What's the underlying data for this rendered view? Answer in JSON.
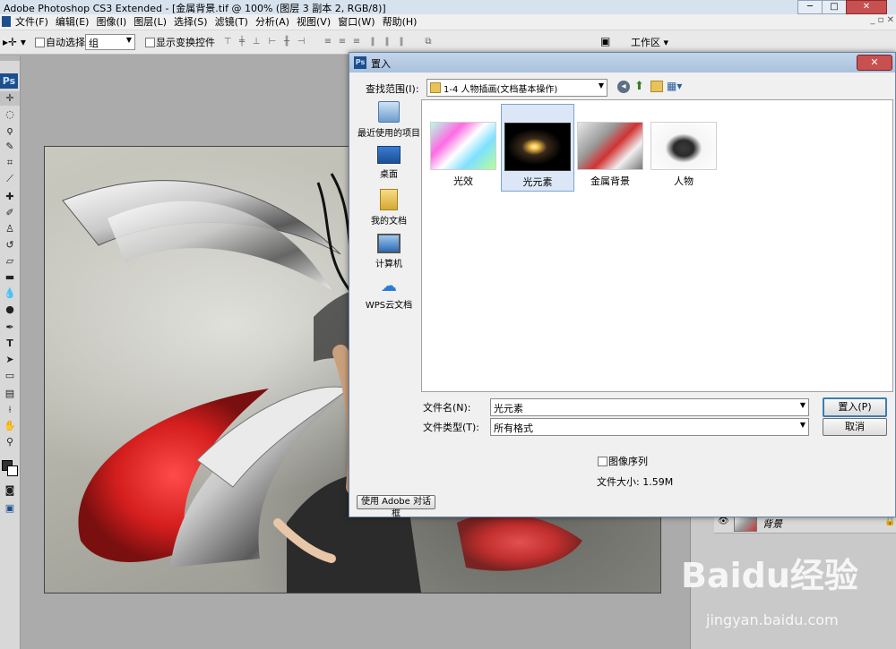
{
  "window": {
    "title": "Adobe Photoshop CS3 Extended - [金属背景.tif @ 100% (图层 3 副本 2, RGB/8)]"
  },
  "menubar": {
    "items": [
      "文件(F)",
      "编辑(E)",
      "图像(I)",
      "图层(L)",
      "选择(S)",
      "滤镜(T)",
      "分析(A)",
      "视图(V)",
      "窗口(W)",
      "帮助(H)"
    ]
  },
  "optionsbar": {
    "auto_select_label": "自动选择:",
    "auto_select_value": "组",
    "show_transform_label": "显示变换控件",
    "workspace_label": "工作区 ▾"
  },
  "tools": {
    "logo": "Ps"
  },
  "layers": {
    "bg_name": "背景"
  },
  "dialog": {
    "icon": "Ps",
    "title": "置入",
    "look_in_label": "查找范围(I):",
    "look_in_value": "1-4 人物插画(文档基本操作)",
    "places": [
      "最近使用的项目",
      "桌面",
      "我的文档",
      "计算机",
      "WPS云文档"
    ],
    "files": [
      "光效",
      "光元素",
      "金属背景",
      "人物"
    ],
    "selected_file": "光元素",
    "filename_label": "文件名(N):",
    "filename_value": "光元素",
    "filetype_label": "文件类型(T):",
    "filetype_value": "所有格式",
    "place_button": "置入(P)",
    "cancel_button": "取消",
    "image_sequence_label": "图像序列",
    "file_size": "文件大小: 1.59M",
    "adobe_dialog_button": "使用 Adobe 对话框"
  },
  "watermark": {
    "text": "Baidu经验",
    "url": "jingyan.baidu.com"
  }
}
